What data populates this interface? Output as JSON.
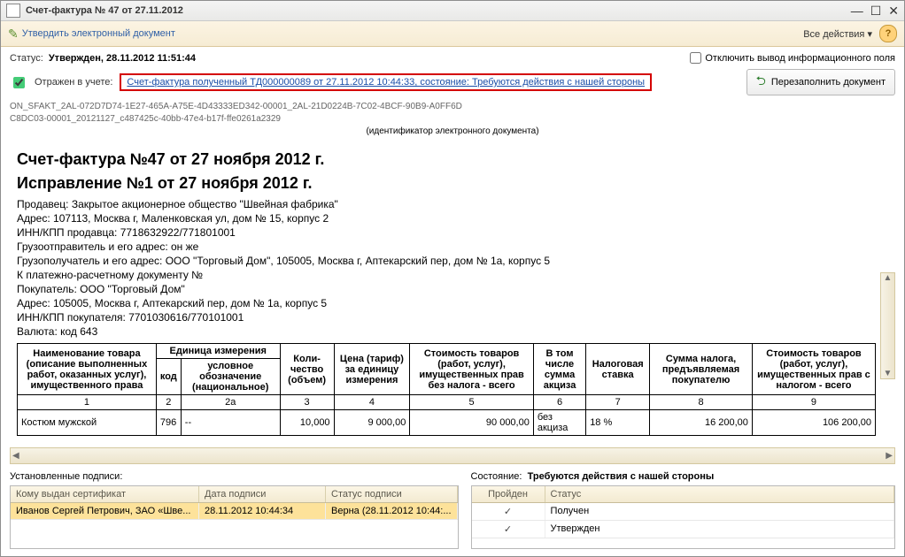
{
  "window": {
    "title": "Счет-фактура № 47 от 27.11.2012"
  },
  "toolbar": {
    "approve_label": "Утвердить электронный документ",
    "actions_label": "Все действия"
  },
  "status": {
    "label": "Статус:",
    "value": "Утвержден, 28.11.2012 11:51:44",
    "suppress_info_label": "Отключить вывод информационного поля"
  },
  "linkrow": {
    "reflected_label": "Отражен в учете:",
    "link_text": "Счет-фактура полученный ТД000000089 от 27.11.2012 10:44:33, состояние: Требуются действия с нашей стороны",
    "refill_label": "Перезаполнить документ"
  },
  "tech": {
    "line1": "ON_SFAKT_2AL-072D7D74-1E27-465A-A75E-4D43333ED342-00001_2AL-21D0224B-7C02-4BCF-90B9-A0FF6D",
    "line2": "C8DC03-00001_20121127_c487425c-40bb-47e4-b17f-ffe0261a2329",
    "id_caption": "(идентификатор электронного документа)"
  },
  "document": {
    "title1": "Счет-фактура №47 от 27 ноября 2012 г.",
    "title2": "Исправление №1 от 27 ноября 2012 г.",
    "seller": "Продавец: Закрытое акционерное общество \"Швейная фабрика\"",
    "seller_addr": "Адрес: 107113, Москва г, Маленковская ул, дом № 15, корпус 2",
    "seller_inn": "ИНН/КПП продавца: 7718632922/771801001",
    "shipper": "Грузоотправитель и его адрес: он же",
    "consignee": "Грузополучатель и его адрес: ООО \"Торговый Дом\", 105005, Москва г, Аптекарский пер, дом № 1а, корпус 5",
    "paydoc": "К платежно-расчетному документу №",
    "buyer": "Покупатель: ООО \"Торговый Дом\"",
    "buyer_addr": "Адрес: 105005, Москва г, Аптекарский пер, дом № 1а, корпус 5",
    "buyer_inn": "ИНН/КПП покупателя: 7701030616/770101001",
    "currency": "Валюта: код 643"
  },
  "table": {
    "headers": {
      "name": "Наименование товара (описание выполненных работ, оказанных услуг), имущественного права",
      "unit": "Единица измерения",
      "unit_code": "код",
      "unit_name": "условное обозначение (национальное)",
      "qty": "Коли-чество (объем)",
      "price": "Цена (тариф) за единицу измерения",
      "cost_notax": "Стоимость товаров (работ, услуг), имущественных прав без налога - всего",
      "excise": "В том числе сумма акциза",
      "taxrate": "Налоговая ставка",
      "taxsum": "Сумма налога, предъявляемая покупателю",
      "cost_tax": "Стоимость товаров (работ, услуг), имущественных прав с налогом - всего"
    },
    "colnums": {
      "c1": "1",
      "c2": "2",
      "c2a": "2а",
      "c3": "3",
      "c4": "4",
      "c5": "5",
      "c6": "6",
      "c7": "7",
      "c8": "8",
      "c9": "9"
    },
    "rows": [
      {
        "name": "Костюм мужской",
        "code": "796",
        "uname": "--",
        "qty": "10,000",
        "price": "9 000,00",
        "cost_notax": "90 000,00",
        "excise": "без акциза",
        "rate": "18 %",
        "taxsum": "16 200,00",
        "cost_tax": "106 200,00"
      }
    ]
  },
  "sign_panel": {
    "caption": "Установленные подписи:",
    "headers": {
      "who": "Кому выдан сертификат",
      "date": "Дата подписи",
      "status": "Статус подписи"
    },
    "rows": [
      {
        "who": "Иванов Сергей Петрович, ЗАО «Шве...",
        "date": "28.11.2012 10:44:34",
        "status": "Верна (28.11.2012 10:44:..."
      }
    ]
  },
  "state_panel": {
    "caption_label": "Состояние:",
    "caption_value": "Требуются действия с нашей стороны",
    "headers": {
      "passed": "Пройден",
      "status": "Статус"
    },
    "rows": [
      {
        "passed": "✓",
        "status": "Получен"
      },
      {
        "passed": "✓",
        "status": "Утвержден"
      }
    ]
  }
}
